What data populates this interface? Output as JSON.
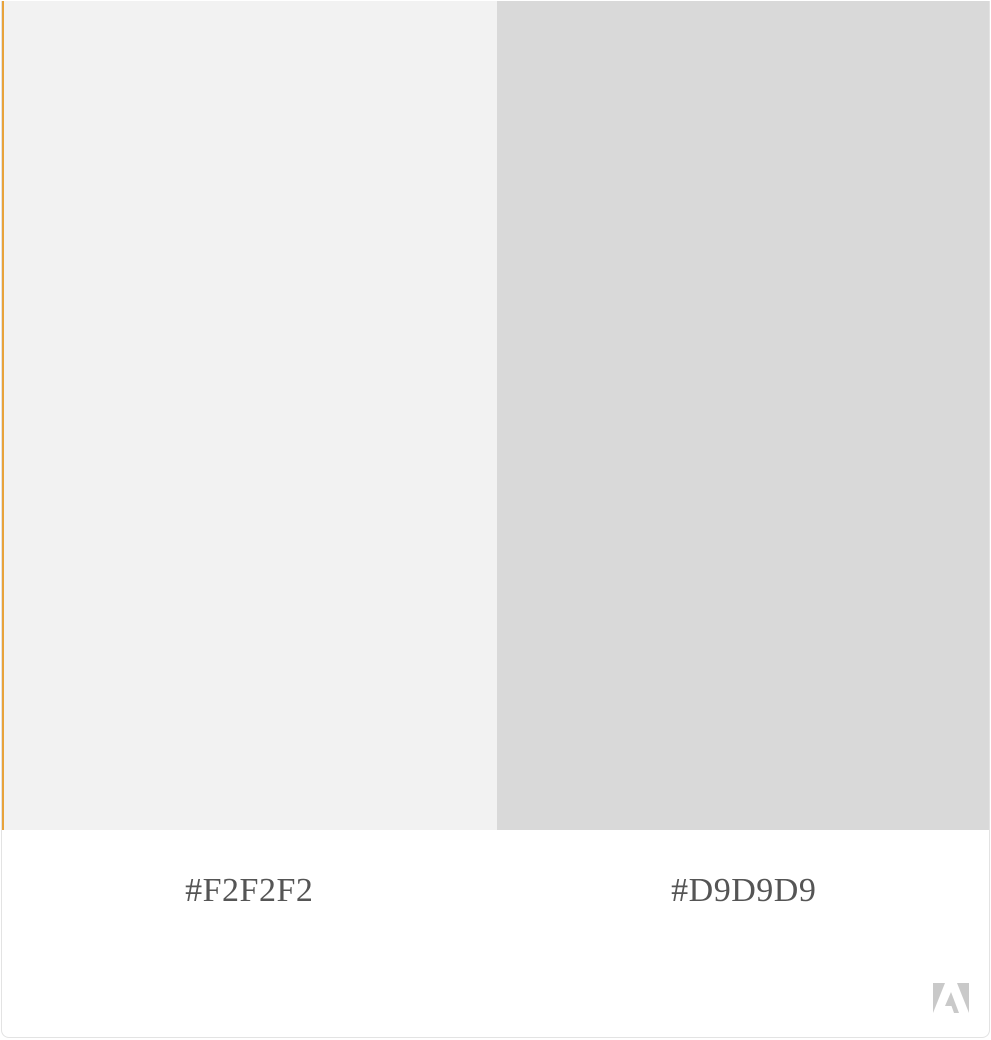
{
  "palette": {
    "swatches": [
      {
        "hex": "#F2F2F2",
        "color": "#F2F2F2"
      },
      {
        "hex": "#D9D9D9",
        "color": "#D9D9D9"
      }
    ],
    "accent_edge_color": "#E8A33B"
  },
  "branding": {
    "logo_icon": "adobe-logo-icon"
  }
}
